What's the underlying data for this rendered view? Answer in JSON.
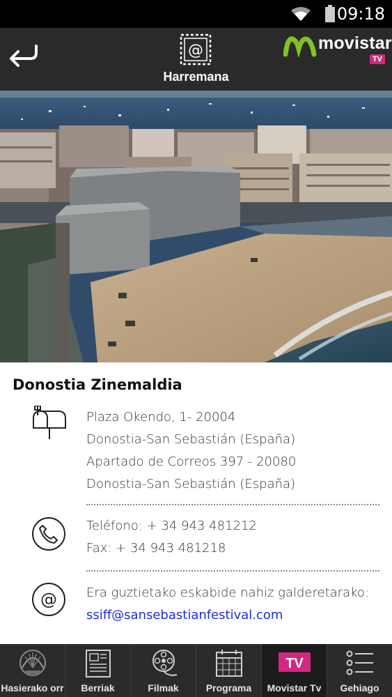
{
  "status_bar": {
    "time": "09:18",
    "icons": [
      "wifi-icon",
      "battery-icon"
    ]
  },
  "header": {
    "title": "Harremana",
    "brand_name": "movistar",
    "brand_badge": "TV",
    "icon": "at-stamp-icon",
    "back_icon": "back-arrow-icon"
  },
  "contact": {
    "venue_name": "Donostia Zinemaldia",
    "address_lines": [
      "Plaza Okendo, 1- 20004",
      "Donostia-San Sebastián (España)",
      "Apartado de Correos 397 - 20080",
      "Donostia-San Sebastián (España)"
    ],
    "phone": "Teléfono: + 34 943 481212",
    "fax": "Fax: + 34 943 481218",
    "email_label": "Era guztietako eskabide nahiz galderetarako:",
    "email": "ssiff@sansebastianfestival.com"
  },
  "tabs": [
    {
      "label": "Hasierako orr",
      "icon": "shell-logo-icon"
    },
    {
      "label": "Berriak",
      "icon": "newspaper-icon"
    },
    {
      "label": "Filmak",
      "icon": "film-reel-icon"
    },
    {
      "label": "Programa",
      "icon": "calendar-icon"
    },
    {
      "label": "Movistar Tv",
      "icon": "tv-icon"
    },
    {
      "label": "Gehiago",
      "icon": "more-list-icon"
    }
  ],
  "colors": {
    "accent_green": "#7fc41f",
    "accent_magenta": "#d3287f",
    "link": "#1a2fd4"
  }
}
